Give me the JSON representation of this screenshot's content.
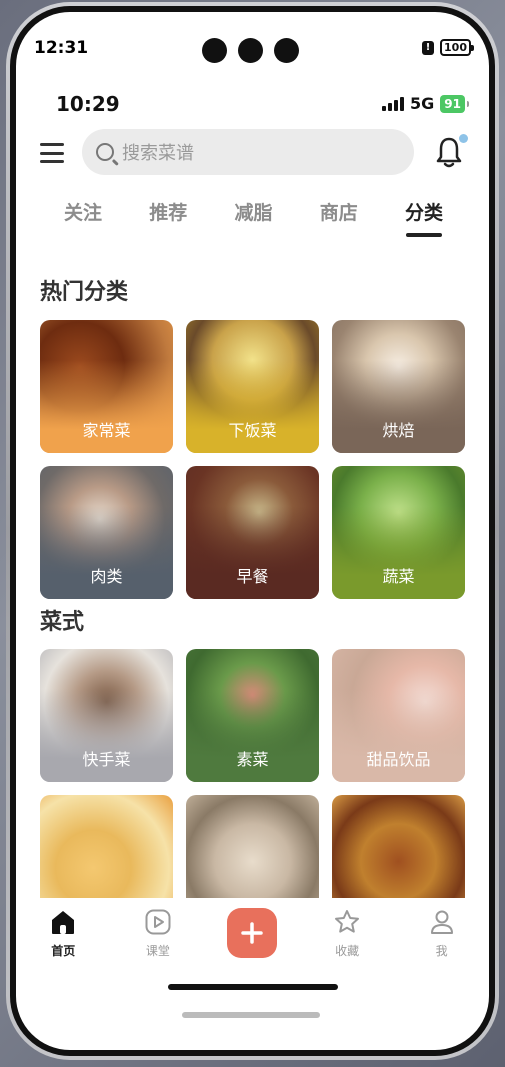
{
  "device": {
    "time": "12:31",
    "battery": "100"
  },
  "app_status": {
    "time": "10:29",
    "network": "5G",
    "battery": "91"
  },
  "header": {
    "search_placeholder": "搜索菜谱"
  },
  "tabs": [
    {
      "label": "关注"
    },
    {
      "label": "推荐"
    },
    {
      "label": "减脂"
    },
    {
      "label": "商店"
    },
    {
      "label": "分类",
      "active": true
    }
  ],
  "sections": {
    "hot": {
      "title": "热门分类",
      "items": [
        {
          "label": "家常菜",
          "color": "#f0a24c"
        },
        {
          "label": "下饭菜",
          "color": "#d8b22a"
        },
        {
          "label": "烘焙",
          "color": "#7a6658"
        },
        {
          "label": "肉类",
          "color": "#56606c"
        },
        {
          "label": "早餐",
          "color": "#5a2a22"
        },
        {
          "label": "蔬菜",
          "color": "#7a9a2c"
        }
      ]
    },
    "style": {
      "title": "菜式",
      "items": [
        {
          "label": "快手菜",
          "color": "#a8a8ae"
        },
        {
          "label": "素菜",
          "color": "#4f7a3e"
        },
        {
          "label": "甜品饮品",
          "color": "#d9b8a8"
        },
        {
          "label": "",
          "color": "#e9b95c"
        },
        {
          "label": "",
          "color": "#c9b8a4"
        },
        {
          "label": "",
          "color": "#c0802e"
        }
      ]
    }
  },
  "bottom_nav": [
    {
      "label": "首页",
      "icon": "home-icon",
      "active": true
    },
    {
      "label": "课堂",
      "icon": "play-icon"
    },
    {
      "label": "",
      "icon": "plus-icon"
    },
    {
      "label": "收藏",
      "icon": "star-icon"
    },
    {
      "label": "我",
      "icon": "user-icon"
    }
  ]
}
